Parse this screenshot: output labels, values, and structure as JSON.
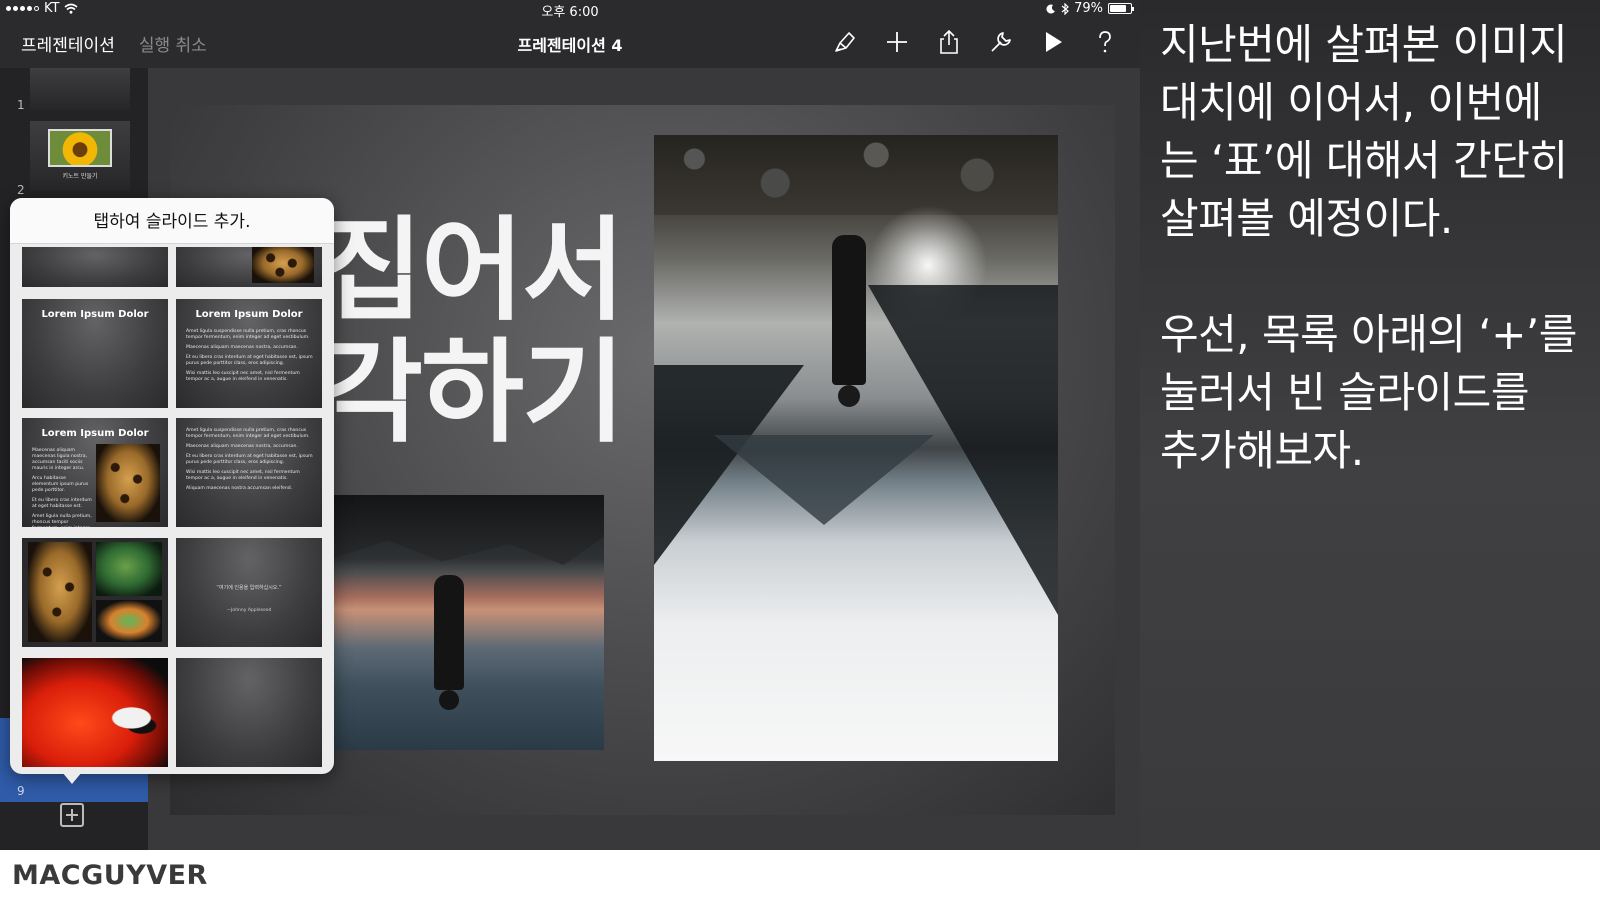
{
  "status_bar": {
    "carrier": "KT",
    "time": "오후 6:00",
    "battery": "79%",
    "battery_level": 0.79
  },
  "toolbar": {
    "back_label": "프레젠테이션",
    "undo_label": "실행 취소",
    "doc_title": "프레젠테이션 4",
    "icons": [
      "paintbrush-icon",
      "plus-icon",
      "share-icon",
      "wrench-icon",
      "play-icon",
      "help-icon"
    ]
  },
  "navigator": {
    "slide_numbers": [
      "1",
      "2",
      "9"
    ],
    "thumb2_caption": "키노트 만들기"
  },
  "slide": {
    "title_line1": "집어서",
    "title_line2": "각하기"
  },
  "popover": {
    "header": "탭하여 슬라이드 추가.",
    "layout_title": "Lorem Ipsum Dolor",
    "bullets": [
      "Amet ligula suspendisse nulla pretium, cras rhoncus tempor fermentum, enim integer ad eget vestibulum.",
      "Maecenas aliquam maecenas nostra, accumsan.",
      "Et eu libero cras interdum at eget habitasse est, ipsum purus pede porttitor class, eros adipiscing.",
      "Wisi mattis leo suscipit nec amet, nisl fermentum tempor ac a, augue in eleifend in venenatis."
    ],
    "bullets_short": [
      "Maecenas aliquam maecenas ligula nostra, accumsan taciti sociis mauris in integer arcu.",
      "Arcu habitasse elementum ipsum purus pede porttitor.",
      "Et eu libero cras interdum at eget habitasse est.",
      "Amet ligula nulla pretium, rhoncus tempor fermentum, enim integer ad eget."
    ],
    "last_bullet": "Aliquam maecenas nostra accumsan eleifend.",
    "quote": "“여기에 인용을 입력하십시오.”",
    "quote_author": "—Johnny Appleseed"
  },
  "caption": {
    "paragraph1": [
      "지난번에 살펴본 이미지",
      "대치에 이어서, 이번에",
      "는 ‘표’에 대해서 간단히",
      "살펴볼 예정이다."
    ],
    "paragraph2": [
      "우선, 목록 아래의 ‘+’를",
      "눌러서 빈 슬라이드를",
      "추가해보자."
    ]
  },
  "footer": {
    "brand": "MACGUYVER"
  }
}
